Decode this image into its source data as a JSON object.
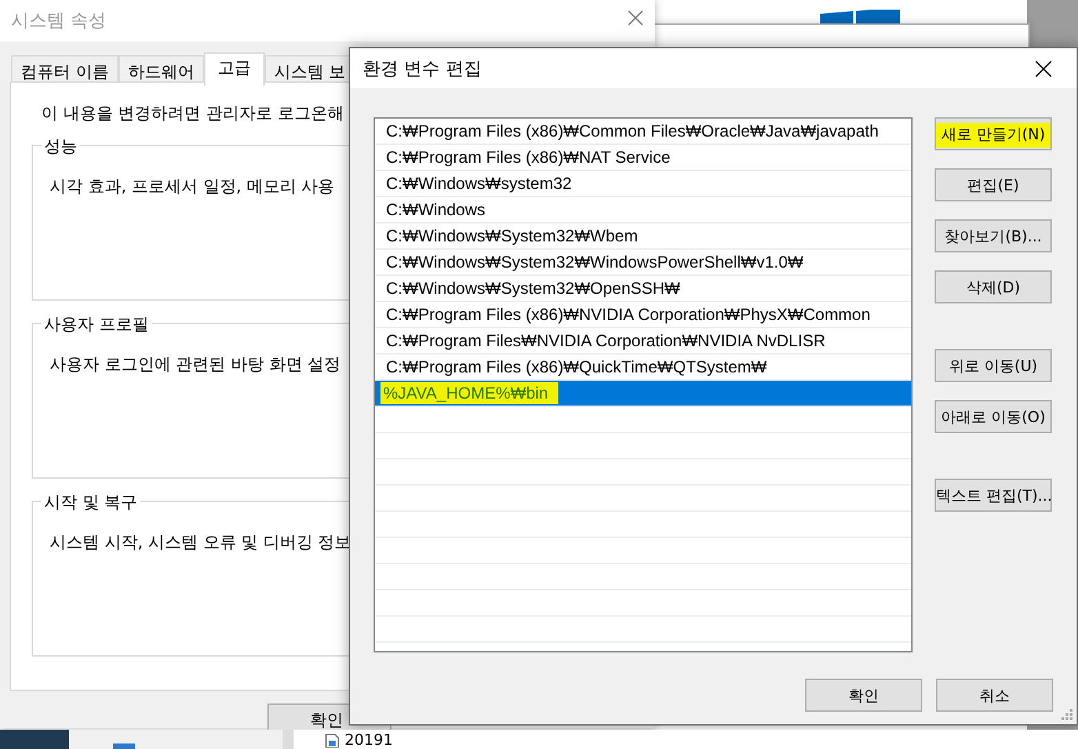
{
  "back_window": {
    "title": "시스템 속성",
    "tabs": [
      {
        "label": "컴퓨터 이름",
        "selected": false
      },
      {
        "label": "하드웨어",
        "selected": false
      },
      {
        "label": "고급",
        "selected": true
      },
      {
        "label": "시스템 보",
        "selected": false
      }
    ],
    "notice": "이 내용을 변경하려면 관리자로 로그온해",
    "groups": [
      {
        "title": "성능",
        "text": "시각 효과, 프로세서 일정, 메모리 사용"
      },
      {
        "title": "사용자 프로필",
        "text": "사용자 로그인에 관련된 바탕 화면 설정"
      },
      {
        "title": "시작 및 복구",
        "text": "시스템 시작, 시스템 오류 및 디버깅 정보"
      }
    ],
    "ok_button": "확인"
  },
  "desktop": {
    "file_label": "20191"
  },
  "dialog": {
    "title": "환경 변수 편집",
    "items": [
      {
        "text": "C:₩Program Files (x86)₩Common Files₩Oracle₩Java₩javapath",
        "selected": false,
        "highlighted": false
      },
      {
        "text": "C:₩Program Files (x86)₩NAT Service",
        "selected": false,
        "highlighted": false
      },
      {
        "text": "C:₩Windows₩system32",
        "selected": false,
        "highlighted": false
      },
      {
        "text": "C:₩Windows",
        "selected": false,
        "highlighted": false
      },
      {
        "text": "C:₩Windows₩System32₩Wbem",
        "selected": false,
        "highlighted": false
      },
      {
        "text": "C:₩Windows₩System32₩WindowsPowerShell₩v1.0₩",
        "selected": false,
        "highlighted": false
      },
      {
        "text": "C:₩Windows₩System32₩OpenSSH₩",
        "selected": false,
        "highlighted": false
      },
      {
        "text": "C:₩Program Files (x86)₩NVIDIA Corporation₩PhysX₩Common",
        "selected": false,
        "highlighted": false
      },
      {
        "text": "C:₩Program Files₩NVIDIA Corporation₩NVIDIA NvDLISR",
        "selected": false,
        "highlighted": false
      },
      {
        "text": "C:₩Program Files (x86)₩QuickTime₩QTSystem₩",
        "selected": false,
        "highlighted": false
      },
      {
        "text": "%JAVA_HOME%₩bin",
        "selected": true,
        "highlighted": true
      }
    ],
    "button_groups": [
      [
        {
          "label": "새로 만들기(N)",
          "highlighted": true
        },
        {
          "label": "편집(E)",
          "highlighted": false
        },
        {
          "label": "찾아보기(B)...",
          "highlighted": false
        },
        {
          "label": "삭제(D)",
          "highlighted": false
        }
      ],
      [
        {
          "label": "위로 이동(U)",
          "highlighted": false
        },
        {
          "label": "아래로 이동(O)",
          "highlighted": false
        }
      ],
      [
        {
          "label": "텍스트 편집(T)...",
          "highlighted": false
        }
      ]
    ],
    "footer_buttons": [
      "확인",
      "취소"
    ]
  }
}
